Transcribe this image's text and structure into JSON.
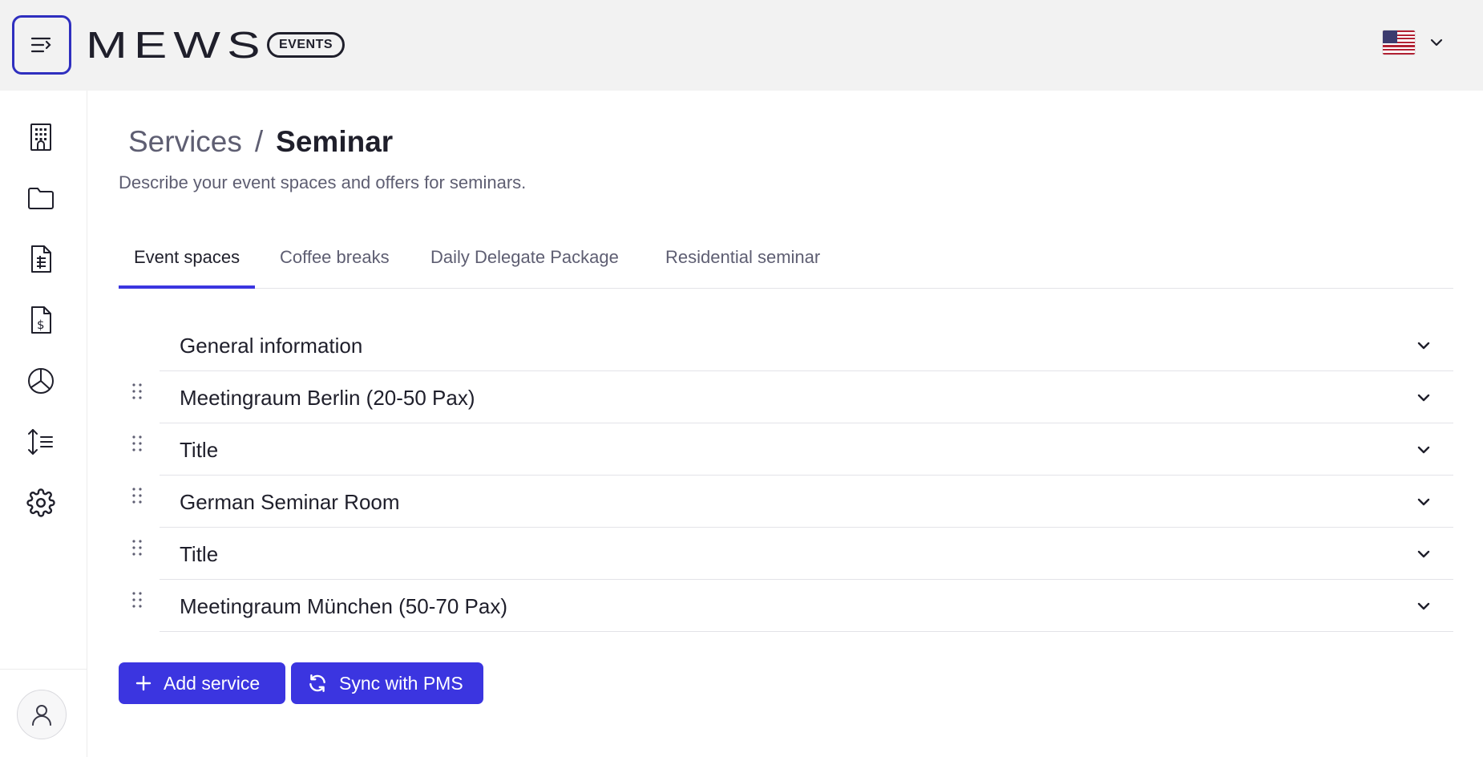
{
  "header": {
    "logo_text": "MEWS",
    "badge": "EVENTS",
    "language_flag": "us-flag-icon"
  },
  "sidebar": {
    "items": [
      {
        "name": "building-icon"
      },
      {
        "name": "folder-icon"
      },
      {
        "name": "document-list-icon"
      },
      {
        "name": "invoice-dollar-icon"
      },
      {
        "name": "pie-chart-icon"
      },
      {
        "name": "sort-list-icon"
      },
      {
        "name": "gear-icon"
      }
    ],
    "avatar": "user-icon"
  },
  "page": {
    "breadcrumb_parent": "Services",
    "breadcrumb_separator": "/",
    "breadcrumb_current": "Seminar",
    "subtitle": "Describe your event spaces and offers for seminars."
  },
  "tabs": [
    {
      "label": "Event spaces",
      "active": true
    },
    {
      "label": "Coffee breaks",
      "active": false
    },
    {
      "label": "Daily Delegate Package",
      "active": false
    },
    {
      "label": "Residential seminar",
      "active": false
    }
  ],
  "sections": [
    {
      "label": "General information",
      "draggable": false
    },
    {
      "label": "Meetingraum Berlin (20-50 Pax)",
      "draggable": true
    },
    {
      "label": "Title",
      "draggable": true
    },
    {
      "label": "German Seminar Room",
      "draggable": true
    },
    {
      "label": "Title",
      "draggable": true
    },
    {
      "label": "Meetingraum München (50-70 Pax)",
      "draggable": true
    }
  ],
  "actions": {
    "add_service": "Add service",
    "sync_pms": "Sync with PMS"
  },
  "colors": {
    "accent": "#3b35e0",
    "text": "#1f1f2b",
    "muted": "#5e5e72",
    "topbar": "#f2f2f2"
  }
}
